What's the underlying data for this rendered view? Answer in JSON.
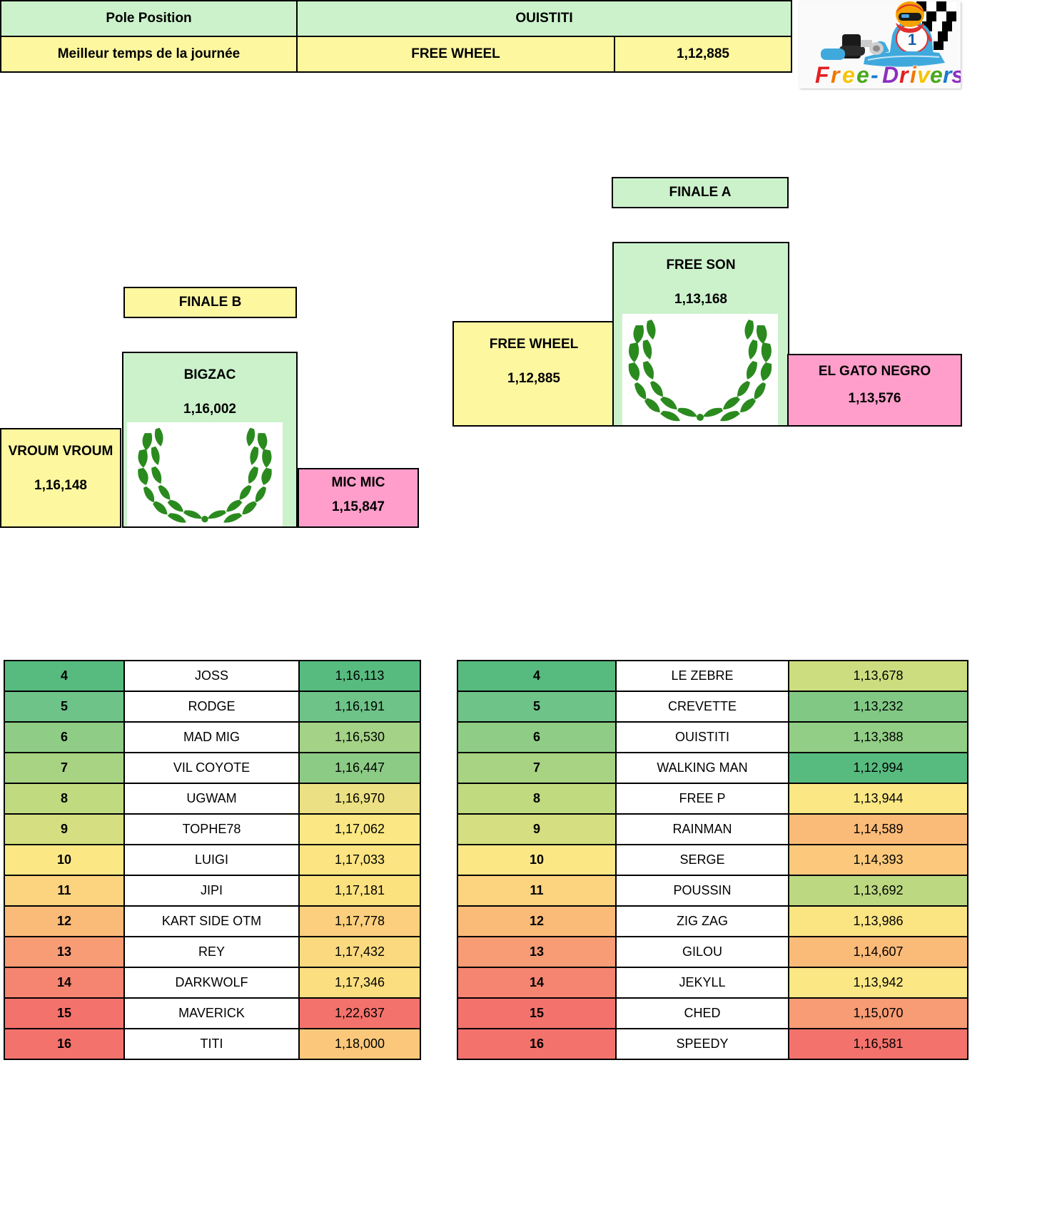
{
  "summary": {
    "rows": [
      {
        "label": "Pole Position",
        "driver": "OUISTITI",
        "time": ""
      },
      {
        "label": "Meilleur temps de la journée",
        "driver": "FREE WHEEL",
        "time": "1,12,885"
      }
    ]
  },
  "logo": {
    "text_free": "Free",
    "text_dash": "-",
    "text_drivers": "Drivers",
    "kart_number": "1",
    "alt": "Free-Drivers karting logo"
  },
  "podiums": {
    "finale_a": {
      "title": "FINALE A",
      "first": {
        "name": "FREE SON",
        "time": "1,13,168"
      },
      "second": {
        "name": "FREE WHEEL",
        "time": "1,12,885"
      },
      "third": {
        "name": "EL GATO NEGRO",
        "time": "1,13,576"
      }
    },
    "finale_b": {
      "title": "FINALE B",
      "first": {
        "name": "BIGZAC",
        "time": "1,16,002"
      },
      "second": {
        "name": "VROUM VROUM",
        "time": "1,16,148"
      },
      "third": {
        "name": "MIC MIC",
        "time": "1,15,847"
      }
    }
  },
  "colors": {
    "green_light": "#ccf2cc",
    "yellow_light": "#fdf7a0",
    "pink": "#ff9ecb",
    "scale": [
      "#57bb7f",
      "#6ec388",
      "#8fcd86",
      "#a8d382",
      "#c7dd80",
      "#e0e380",
      "#fbe884",
      "#fcd37f",
      "#fbbb78",
      "#f79c74",
      "#f58470",
      "#f4726c"
    ]
  },
  "tables": {
    "finale_b_results": {
      "rows": [
        {
          "rank": "4",
          "name": "JOSS",
          "time": "1,16,113",
          "rank_color": "#57bb7f",
          "time_color": "#57bb7f"
        },
        {
          "rank": "5",
          "name": "RODGE",
          "time": "1,16,191",
          "rank_color": "#6ec388",
          "time_color": "#6ec388"
        },
        {
          "rank": "6",
          "name": "MAD MIG",
          "time": "1,16,530",
          "rank_color": "#8fcd86",
          "time_color": "#a4d287"
        },
        {
          "rank": "7",
          "name": "VIL COYOTE",
          "time": "1,16,447",
          "rank_color": "#a8d382",
          "time_color": "#8ccb85"
        },
        {
          "rank": "8",
          "name": "UGWAM",
          "time": "1,16,970",
          "rank_color": "#c0da80",
          "time_color": "#ebe083"
        },
        {
          "rank": "9",
          "name": "TOPHE78",
          "time": "1,17,062",
          "rank_color": "#d5de80",
          "time_color": "#fbe884"
        },
        {
          "rank": "10",
          "name": "LUIGI",
          "time": "1,17,033",
          "rank_color": "#fbe884",
          "time_color": "#fbe481"
        },
        {
          "rank": "11",
          "name": "JIPI",
          "time": "1,17,181",
          "rank_color": "#fcd37f",
          "time_color": "#fbe27f"
        },
        {
          "rank": "12",
          "name": "KART SIDE OTM",
          "time": "1,17,778",
          "rank_color": "#fbbb78",
          "time_color": "#fbcf7d"
        },
        {
          "rank": "13",
          "name": "REY",
          "time": "1,17,432",
          "rank_color": "#f79c74",
          "time_color": "#fbda7f"
        },
        {
          "rank": "14",
          "name": "DARKWOLF",
          "time": "1,17,346",
          "rank_color": "#f58470",
          "time_color": "#fbde80"
        },
        {
          "rank": "15",
          "name": "MAVERICK",
          "time": "1,22,637",
          "rank_color": "#f4726c",
          "time_color": "#f4726c"
        },
        {
          "rank": "16",
          "name": "TITI",
          "time": "1,18,000",
          "rank_color": "#f4726c",
          "time_color": "#fbc87b"
        }
      ]
    },
    "finale_a_results": {
      "rows": [
        {
          "rank": "4",
          "name": "LE ZEBRE",
          "time": "1,13,678",
          "rank_color": "#57bb7f",
          "time_color": "#ccdd7f"
        },
        {
          "rank": "5",
          "name": "CREVETTE",
          "time": "1,13,232",
          "rank_color": "#6ec388",
          "time_color": "#81c885"
        },
        {
          "rank": "6",
          "name": "OUISTITI",
          "time": "1,13,388",
          "rank_color": "#8fcd86",
          "time_color": "#92ce86"
        },
        {
          "rank": "7",
          "name": "WALKING MAN",
          "time": "1,12,994",
          "rank_color": "#a8d382",
          "time_color": "#57bb7f"
        },
        {
          "rank": "8",
          "name": "FREE P",
          "time": "1,13,944",
          "rank_color": "#c0da80",
          "time_color": "#fbe884"
        },
        {
          "rank": "9",
          "name": "RAINMAN",
          "time": "1,14,589",
          "rank_color": "#d5de80",
          "time_color": "#fbbb78"
        },
        {
          "rank": "10",
          "name": "SERGE",
          "time": "1,14,393",
          "rank_color": "#fbe884",
          "time_color": "#fcc97c"
        },
        {
          "rank": "11",
          "name": "POUSSIN",
          "time": "1,13,692",
          "rank_color": "#fcd37f",
          "time_color": "#bcd881"
        },
        {
          "rank": "12",
          "name": "ZIG ZAG",
          "time": "1,13,986",
          "rank_color": "#fbbb78",
          "time_color": "#fbe482"
        },
        {
          "rank": "13",
          "name": "GILOU",
          "time": "1,14,607",
          "rank_color": "#f79c74",
          "time_color": "#fbbb78"
        },
        {
          "rank": "14",
          "name": "JEKYLL",
          "time": "1,13,942",
          "rank_color": "#f58470",
          "time_color": "#fbe884"
        },
        {
          "rank": "15",
          "name": "CHED",
          "time": "1,15,070",
          "rank_color": "#f4726c",
          "time_color": "#f79c74"
        },
        {
          "rank": "16",
          "name": "SPEEDY",
          "time": "1,16,581",
          "rank_color": "#f4726c",
          "time_color": "#f4726c"
        }
      ]
    }
  }
}
